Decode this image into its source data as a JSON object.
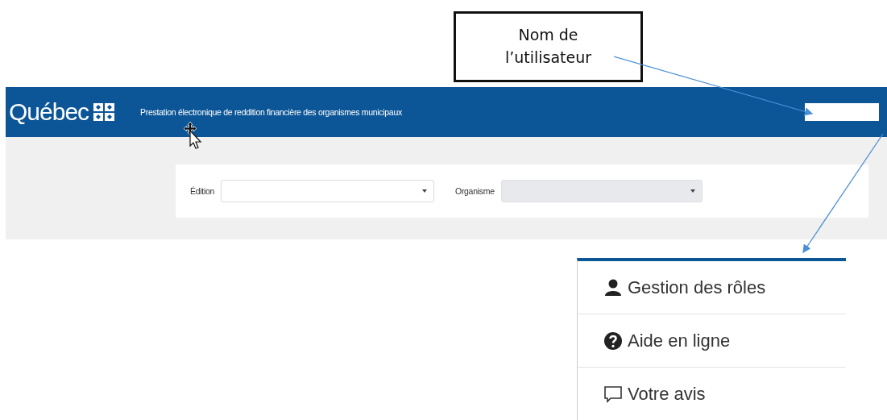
{
  "callout": {
    "text": "Nom de l’utilisateur"
  },
  "header": {
    "logo": "Québec",
    "title": "Prestation électronique de reddition financière des organismes municipaux"
  },
  "filters": [
    {
      "label": "Édition",
      "disabled": false
    },
    {
      "label": "Organisme",
      "disabled": true
    }
  ],
  "user_menu": {
    "items": [
      {
        "kind": "user",
        "label": "Gestion des rôles"
      },
      {
        "kind": "help",
        "label": "Aide en ligne"
      },
      {
        "kind": "feedback",
        "label": "Votre avis"
      }
    ]
  }
}
